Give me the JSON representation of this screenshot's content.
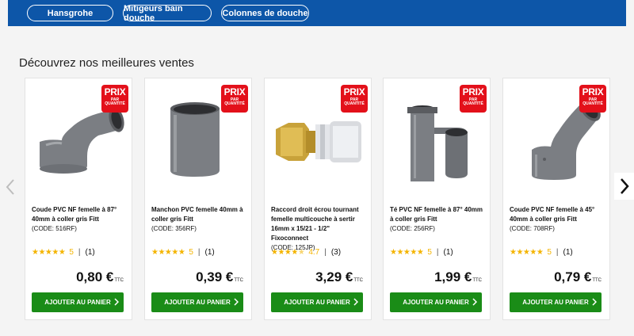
{
  "nav": {
    "pills": [
      "Hansgrohe",
      "Mitigeurs bain douche",
      "Colonnes de douche"
    ]
  },
  "section": {
    "title": "Découvrez nos meilleures ventes"
  },
  "badge": {
    "line1": "PRIX",
    "line2": "PAR",
    "line3": "QUANTITÉ"
  },
  "products": [
    {
      "name": "Coude PVC NF femelle à 87° 40mm à coller gris Fitt",
      "code": "(CODE: 516RF)",
      "stars": 5,
      "score": "5",
      "count": "(1)",
      "price": "0,80 €",
      "ttc": "TTC",
      "button": "AJOUTER AU PANIER",
      "image": "pvc-elbow-87"
    },
    {
      "name": "Manchon PVC femelle 40mm à coller gris Fitt",
      "code": "(CODE: 356RF)",
      "stars": 5,
      "score": "5",
      "count": "(1)",
      "price": "0,39 €",
      "ttc": "TTC",
      "button": "AJOUTER AU PANIER",
      "image": "pvc-sleeve"
    },
    {
      "name": "Raccord droit écrou tournant femelle multicouche à sertir 16mm x 15/21 - 1/2\" Fixoconnect",
      "code": "(CODE: 125JP)",
      "stars": 4.7,
      "score": "4.7",
      "count": "(3)",
      "price": "3,29 €",
      "ttc": "TTC",
      "button": "AJOUTER AU PANIER",
      "image": "brass-fitting"
    },
    {
      "name": "Té PVC NF femelle à 87° 40mm à coller gris Fitt",
      "code": "(CODE: 256RF)",
      "stars": 5,
      "score": "5",
      "count": "(1)",
      "price": "1,99 €",
      "ttc": "TTC",
      "button": "AJOUTER AU PANIER",
      "image": "pvc-tee"
    },
    {
      "name": "Coude PVC NF femelle à 45° 40mm à coller gris Fitt",
      "code": "(CODE: 708RF)",
      "stars": 5,
      "score": "5",
      "count": "(1)",
      "price": "0,79 €",
      "ttc": "TTC",
      "button": "AJOUTER AU PANIER",
      "image": "pvc-elbow-45"
    }
  ],
  "colors": {
    "nav": "#0d56a8",
    "button": "#1a8c17",
    "badge": "#e3101a",
    "stars": "#f4b400"
  }
}
